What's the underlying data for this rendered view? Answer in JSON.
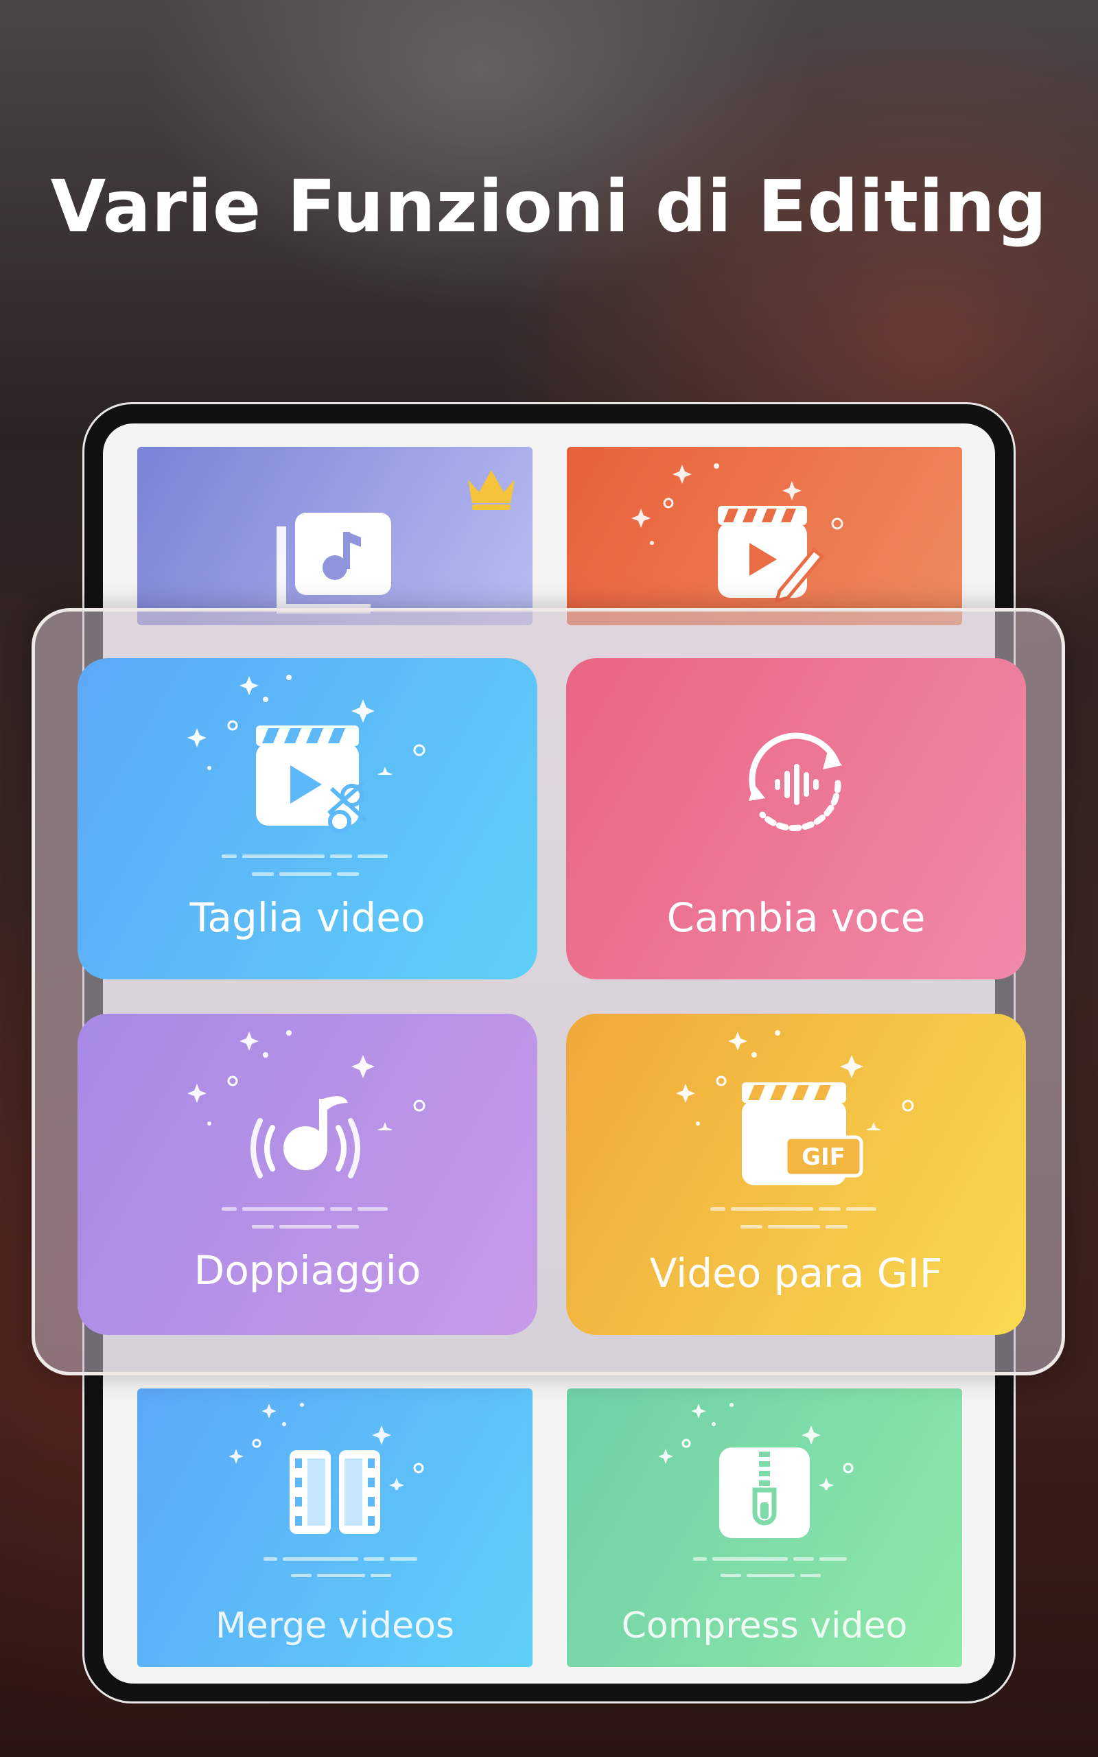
{
  "headline": "Varie Funzioni di Editing",
  "top_tiles": [
    {
      "icon": "music-library-icon",
      "badge": "crown-icon",
      "color_start": "#7a82d6",
      "color_end": "#b8bcf0"
    },
    {
      "icon": "video-edit-icon",
      "color_start": "#e8603a",
      "color_end": "#ef8a5e"
    }
  ],
  "cards": [
    {
      "label": "Taglia video",
      "icon": "video-cut-icon",
      "color_start": "#5ca8f8",
      "color_end": "#5ed0f8"
    },
    {
      "label": "Cambia voce",
      "icon": "voice-change-icon",
      "color_start": "#e96583",
      "color_end": "#ef8aa8"
    },
    {
      "label": "Doppiaggio",
      "icon": "dubbing-icon",
      "color_start": "#a58ae6",
      "color_end": "#c79ae8"
    },
    {
      "label": "Video para GIF",
      "icon": "video-to-gif-icon",
      "color_start": "#f0a83a",
      "color_end": "#f8da50"
    }
  ],
  "bottom_tiles": [
    {
      "label": "Merge videos",
      "icon": "merge-videos-icon",
      "color_start": "#5ca8f8",
      "color_end": "#5ed0f8"
    },
    {
      "label": "Compress video",
      "icon": "compress-video-icon",
      "color_start": "#6fd0a8",
      "color_end": "#8ee8a8"
    }
  ]
}
